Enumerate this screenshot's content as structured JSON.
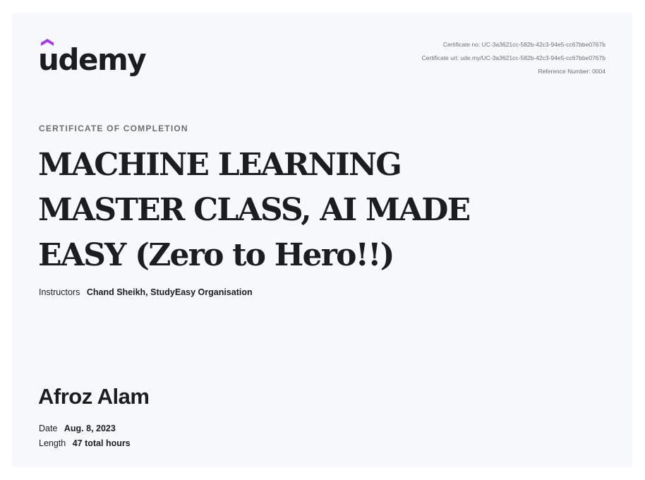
{
  "brand": {
    "logo_text": "udemy",
    "logo_icon": "udemy-hat-icon",
    "accent_color": "#a435f0"
  },
  "meta": {
    "certificate_no": "Certificate no: UC-3a3621cc-582b-42c3-94e5-cc67bbe0767b",
    "certificate_url": "Certificate url: ude.my/UC-3a3621cc-582b-42c3-94e5-cc67bbe0767b",
    "reference_number": "Reference Number: 0004"
  },
  "kicker": "CERTIFICATE OF COMPLETION",
  "course": {
    "title_lines": [
      "MACHINE LEARNING",
      "MASTER CLASS, AI MADE",
      "EASY (Zero to Hero!!)"
    ]
  },
  "instructors": {
    "label": "Instructors",
    "names": "Chand Sheikh,  StudyEasy Organisation"
  },
  "recipient": "Afroz Alam",
  "details": {
    "date_label": "Date",
    "date_value": "Aug. 8, 2023",
    "length_label": "Length",
    "length_value": "47 total hours"
  }
}
